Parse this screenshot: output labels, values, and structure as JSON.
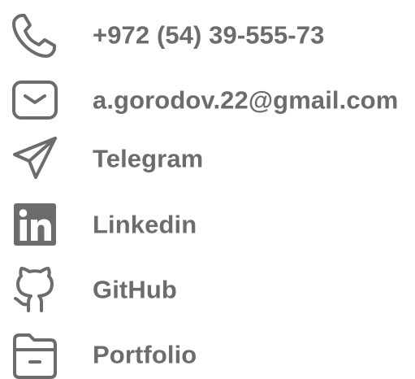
{
  "contacts": [
    {
      "type": "phone",
      "icon": "phone-icon",
      "label": "+972 (54) 39-555-73"
    },
    {
      "type": "email",
      "icon": "mail-icon",
      "label": "a.gorodov.22@gmail.com"
    },
    {
      "type": "telegram",
      "icon": "telegram-icon",
      "label": "Telegram"
    },
    {
      "type": "linkedin",
      "icon": "linkedin-icon",
      "label": "Linkedin"
    },
    {
      "type": "github",
      "icon": "github-icon",
      "label": "GitHub"
    },
    {
      "type": "portfolio",
      "icon": "folder-icon",
      "label": "Portfolio"
    }
  ],
  "colors": {
    "text": "#6c6c6c",
    "icon": "#6c6c6c",
    "background": "#ffffff"
  }
}
